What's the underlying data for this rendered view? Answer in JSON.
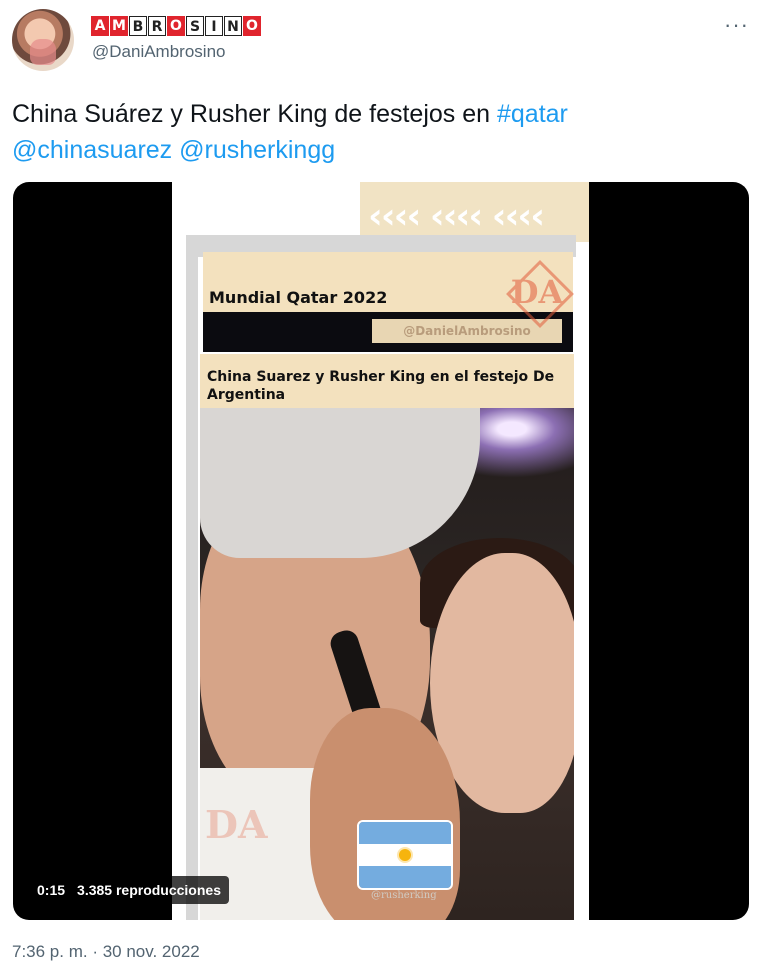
{
  "author": {
    "display_name_letters": [
      "A",
      "M",
      "B",
      "R",
      "O",
      "S",
      "I",
      "N",
      "O"
    ],
    "handle": "@DaniAmbrosino",
    "avatar_icon": "avatar-photo"
  },
  "menu": {
    "more_label": "···"
  },
  "tweet": {
    "text_main": "China Suárez y Rusher King de festejos en ",
    "hashtag": "#qatar",
    "mention1": "@chinasuarez",
    "mention2": "@rusherkingg"
  },
  "video": {
    "banner_arrows": "‹‹‹‹ ‹‹‹‹ ‹‹‹‹",
    "overlay_title": "Mundial Qatar 2022",
    "overlay_handle": "@DanielAmbrosino",
    "overlay_caption": "China Suarez y Rusher King en el festejo De Argentina",
    "logo_text": "DA",
    "watermark": "@rusherking",
    "duration": "0:15",
    "views": "3.385 reproducciones",
    "flag_icon": "argentina-flag-icon"
  },
  "footer": {
    "timestamp": "7:36 p. m. · 30 nov. 2022"
  },
  "colors": {
    "link": "#1d9bf0",
    "meta_gray": "#536471",
    "logo_red": "#e0242d"
  }
}
